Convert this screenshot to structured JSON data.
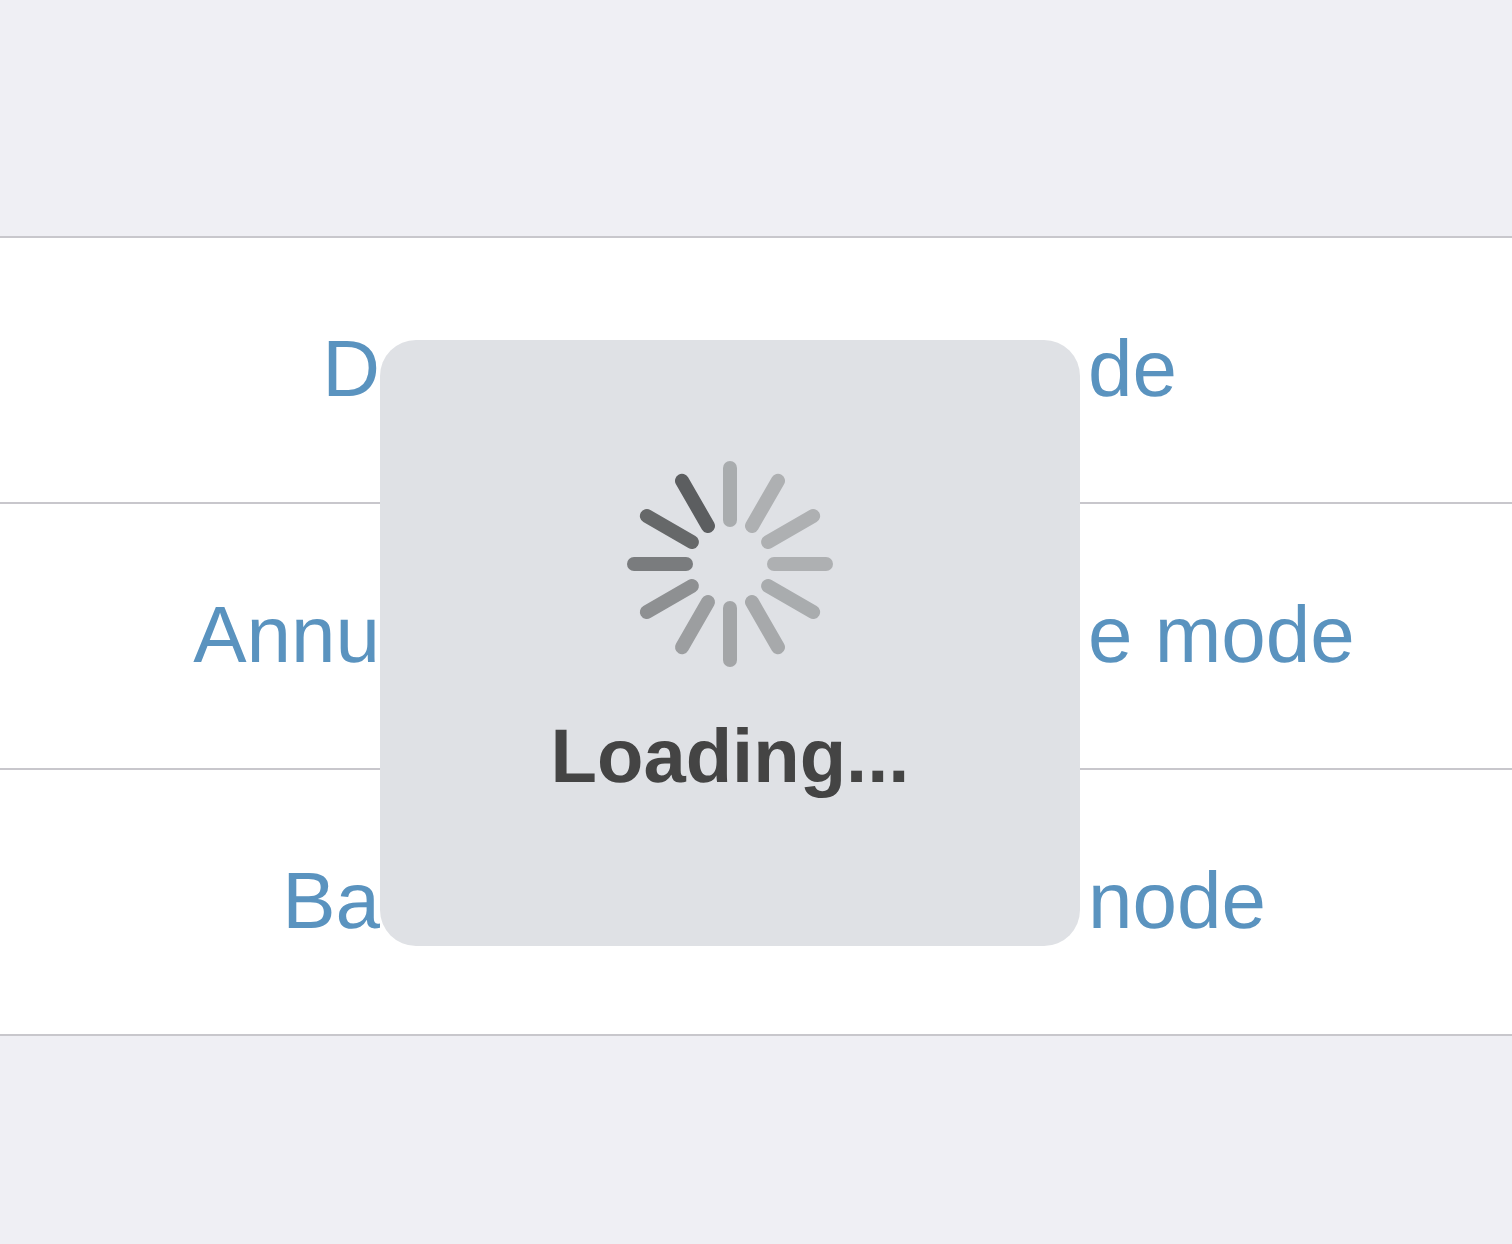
{
  "rows": [
    {
      "left": "D",
      "right": "de"
    },
    {
      "left": "Annu",
      "right": "e mode"
    },
    {
      "left": "Ba",
      "right": "node"
    }
  ],
  "hud": {
    "label": "Loading..."
  }
}
